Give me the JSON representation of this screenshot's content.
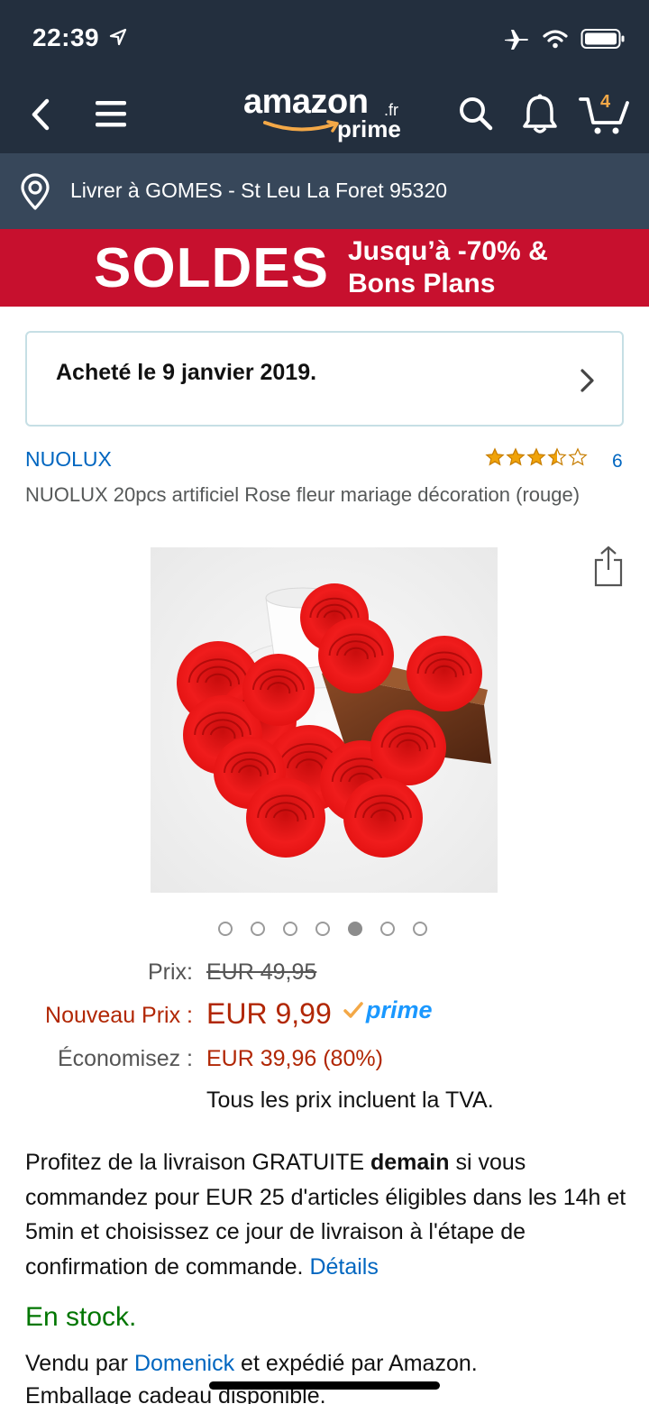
{
  "status_bar": {
    "time": "22:39"
  },
  "nav": {
    "logo_text": "amazon",
    "logo_tld": ".fr",
    "logo_sub": "prime",
    "cart_count": "4"
  },
  "delivery": {
    "text": "Livrer à GOMES - St Leu La Foret 95320"
  },
  "banner": {
    "title": "SOLDES",
    "line1": "Jusqu’à -70% &",
    "line2": "Bons Plans",
    "color": "#c7102e"
  },
  "order": {
    "text": "Acheté le 9 janvier 2019."
  },
  "product": {
    "brand": "NUOLUX",
    "rating": 3.5,
    "rating_max": 5,
    "review_count": "6",
    "title": "NUOLUX 20pcs artificiel Rose fleur mariage décoration (rouge)",
    "image_count": 7,
    "active_image": 5
  },
  "pricing": {
    "price_label": "Prix:",
    "price_value": "EUR 49,95",
    "new_label": "Nouveau Prix :",
    "new_value": "EUR 9,99",
    "prime_label": "prime",
    "save_label": "Économisez :",
    "save_value": "EUR 39,96 (80%)",
    "tva_note": "Tous les prix incluent la TVA."
  },
  "shipping": {
    "part1": "Profitez de la livraison GRATUITE ",
    "bold": "demain",
    "part2": " si vous commandez pour EUR 25 d'articles éligibles dans les 14h et 5min et choisissez ce jour de livraison à l'étape de confirmation de commande. ",
    "details_link": "Détails"
  },
  "stock": {
    "text": "En stock."
  },
  "seller": {
    "prefix": "Vendu par ",
    "name": "Domenick",
    "suffix": " et expédié par Amazon.",
    "line2": "Emballage cadeau disponible."
  },
  "colors": {
    "header": "#232f3e",
    "delivery_bar": "#37475a",
    "price_red": "#b12704",
    "link_blue": "#0066c0",
    "stock_green": "#007600",
    "star_orange": "#f0a30a"
  }
}
